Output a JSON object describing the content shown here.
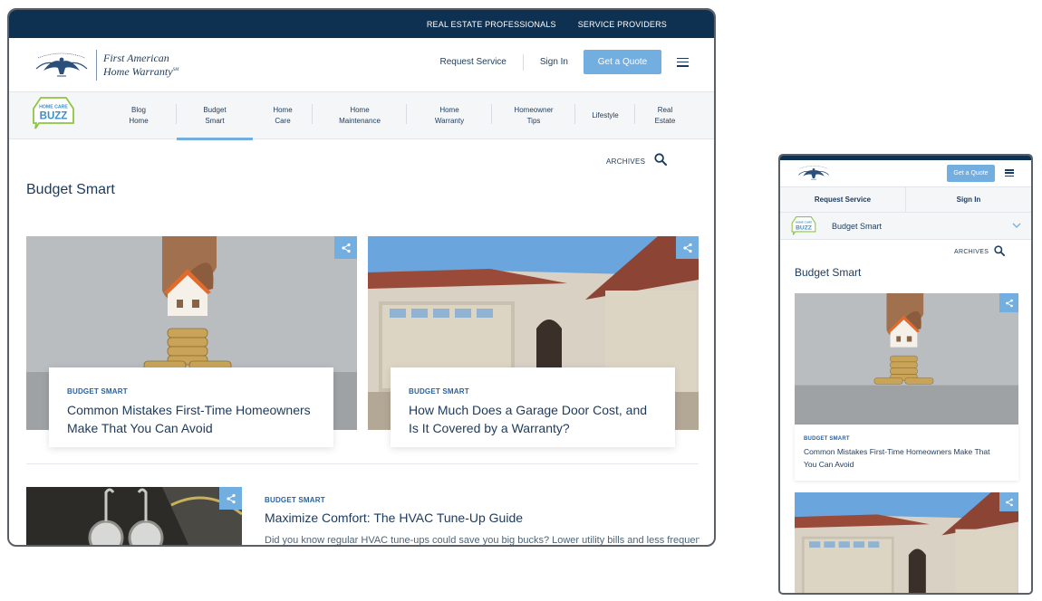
{
  "desktop": {
    "top_links": [
      "REAL ESTATE PROFESSIONALS",
      "SERVICE PROVIDERS"
    ],
    "brand_line1": "First American",
    "brand_line2": "Home Warranty",
    "brand_mark": "SM",
    "nav": {
      "request_service": "Request Service",
      "sign_in": "Sign In",
      "get_quote": "Get a Quote"
    },
    "buzz_logo_line1": "HOME CARE",
    "buzz_logo_line2": "BUZZ",
    "subnav": [
      {
        "line1": "Blog",
        "line2": "Home"
      },
      {
        "line1": "Budget",
        "line2": "Smart",
        "active": true
      },
      {
        "line1": "Home",
        "line2": "Care"
      },
      {
        "line1": "Home",
        "line2": "Maintenance"
      },
      {
        "line1": "Home",
        "line2": "Warranty"
      },
      {
        "line1": "Homeowner",
        "line2": "Tips"
      },
      {
        "line1": "Lifestyle",
        "line2": ""
      },
      {
        "line1": "Real",
        "line2": "Estate"
      }
    ],
    "archives": "ARCHIVES",
    "page_title": "Budget Smart",
    "cards": [
      {
        "category": "BUDGET SMART",
        "title_line1": "Common Mistakes First-Time Homeowners",
        "title_line2": "Make That You Can Avoid",
        "image": "coin-stack-house-photo"
      },
      {
        "category": "BUDGET SMART",
        "title_line1": "How Much Does a Garage Door Cost, and",
        "title_line2": "Is It Covered by a Warranty?",
        "image": "garage-house-photo"
      }
    ],
    "list_item": {
      "category": "BUDGET SMART",
      "title": "Maximize Comfort: The HVAC Tune-Up Guide",
      "excerpt": "Did you know regular HVAC tune-ups could save you big bucks? Lower utility bills and less frequent",
      "image": "hvac-gauges-photo"
    }
  },
  "mobile": {
    "get_quote": "Get a Quote",
    "request_service": "Request Service",
    "sign_in": "Sign In",
    "category": "Budget Smart",
    "archives": "ARCHIVES",
    "page_title": "Budget Smart",
    "card": {
      "category": "BUDGET SMART",
      "title_line1": "Common Mistakes First-Time Homeowners Make That",
      "title_line2": "You Can Avoid"
    }
  },
  "colors": {
    "navy": "#0f3151",
    "accent_blue": "#73aee0",
    "text": "#1c3a5c",
    "category": "#2a62a0"
  }
}
